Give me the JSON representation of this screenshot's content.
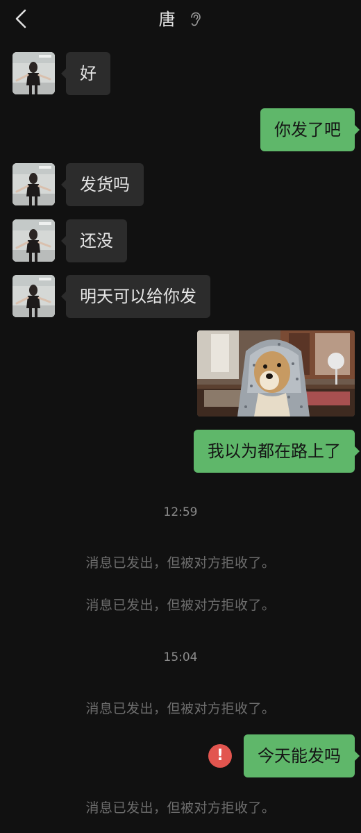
{
  "header": {
    "title": "唐",
    "back_icon": "chevron-left-icon",
    "status_icon": "ear-icon"
  },
  "messages": [
    {
      "side": "in",
      "text": "好"
    },
    {
      "side": "out",
      "text": "你发了吧"
    },
    {
      "side": "in",
      "text": "发货吗"
    },
    {
      "side": "in",
      "text": "还没"
    },
    {
      "side": "in",
      "text": "明天可以给你发"
    },
    {
      "side": "out",
      "type": "image"
    },
    {
      "side": "out",
      "text": "我以为都在路上了"
    },
    {
      "side": "out",
      "text": "今天能发吗",
      "failed": true
    }
  ],
  "timestamps": [
    "12:59",
    "15:04"
  ],
  "system_notes": [
    "消息已发出，但被对方拒收了。",
    "消息已发出，但被对方拒收了。",
    "消息已发出，但被对方拒收了。",
    "消息已发出，但被对方拒收了。"
  ],
  "fail_icon_symbol": "!",
  "colors": {
    "background": "#111111",
    "incoming_bubble": "#2c2c2c",
    "outgoing_bubble": "#5fb76a",
    "error": "#e2554f"
  }
}
